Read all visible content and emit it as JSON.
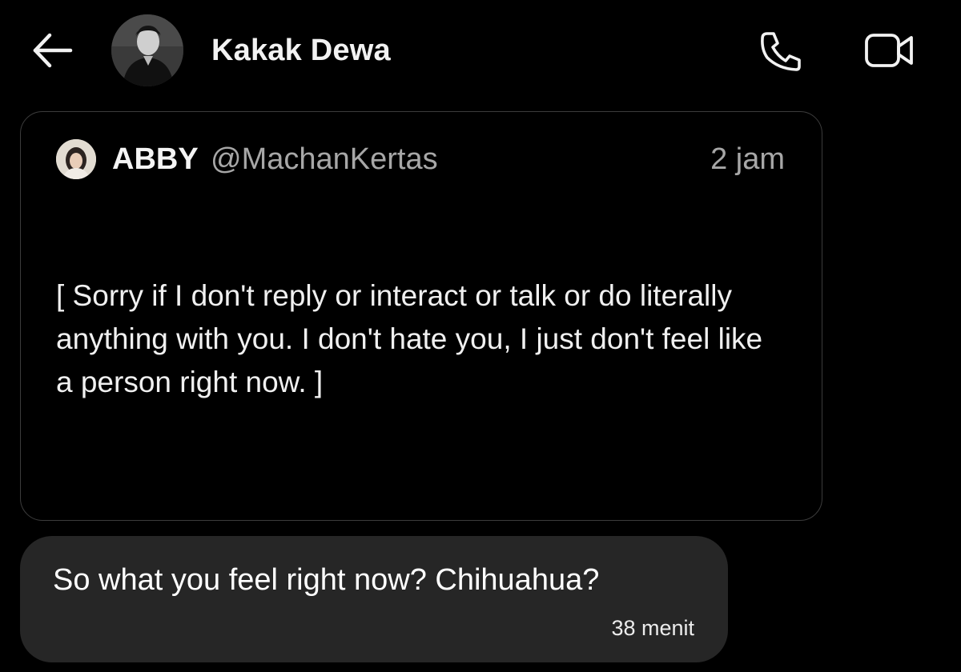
{
  "header": {
    "back_icon": "arrow-left-icon",
    "contact_name": "Kakak Dewa",
    "call_icon": "phone-icon",
    "video_icon": "video-camera-icon"
  },
  "quoted_post": {
    "author_name": "ABBY",
    "author_handle": "@MachanKertas",
    "time": "2 jam",
    "text": "[ Sorry if I don't reply or interact or talk or do literally anything with you. I don't hate you, I just don't feel like a person right now. ]"
  },
  "message": {
    "text": "So what you feel right now? Chihuahua?",
    "time": "38 menit"
  },
  "colors": {
    "background": "#000000",
    "bubble": "#262626",
    "muted_text": "#a7a7a7",
    "card_border": "#3c3c3c"
  }
}
